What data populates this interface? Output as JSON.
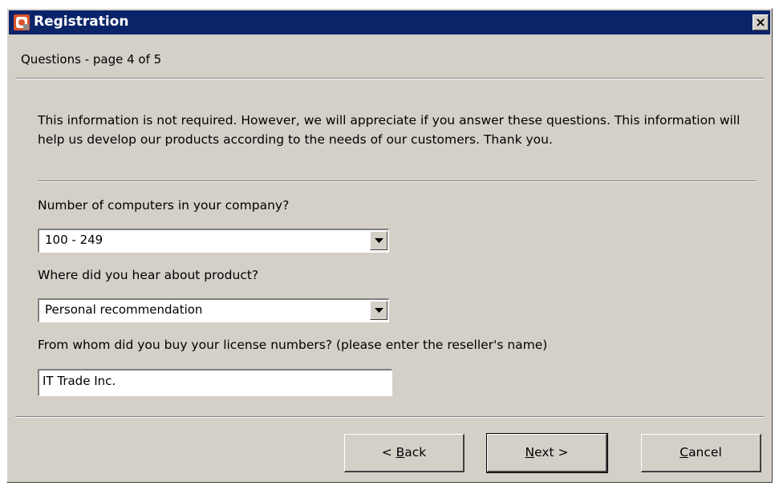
{
  "window": {
    "title": "Registration",
    "close_glyph": "×",
    "title_icon": "registration-app-icon"
  },
  "page": {
    "heading": "Questions - page 4 of 5",
    "intro": "This information is not required. However, we will appreciate if you answer these questions. This information will help us develop our products according to the needs of our customers. Thank you."
  },
  "questions": {
    "computers": {
      "label": "Number of computers in your company?",
      "value": "100 - 249"
    },
    "source": {
      "label": "Where did you hear about product?",
      "value": "Personal recommendation"
    },
    "reseller": {
      "label": "From whom did you buy your license numbers? (please enter the reseller's name)",
      "value": "IT Trade Inc."
    }
  },
  "buttons": {
    "back_prefix": "< ",
    "back_mnemonic": "B",
    "back_rest": "ack",
    "next_mnemonic": "N",
    "next_rest": "ext >",
    "cancel_mnemonic": "C",
    "cancel_rest": "ancel"
  },
  "colors": {
    "titlebar": "#0a246a",
    "dialog_bg": "#d4d0c8"
  }
}
